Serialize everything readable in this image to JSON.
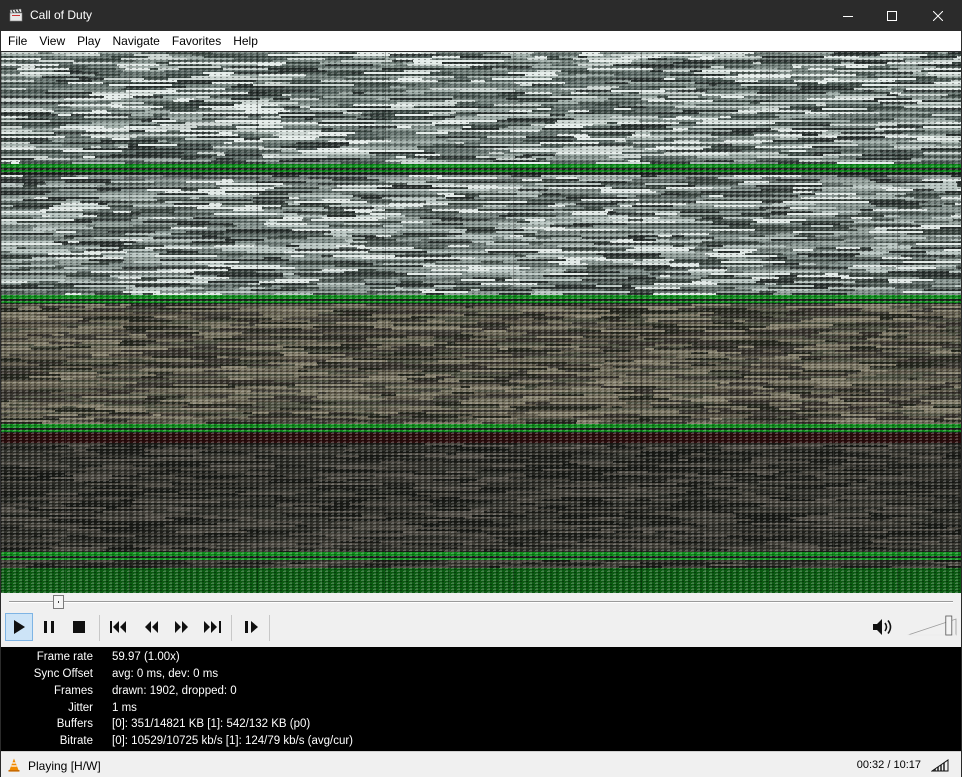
{
  "window": {
    "title": "Call of Duty",
    "icons": {
      "app": "clapperboard-icon",
      "minimize": "minimize-icon",
      "maximize": "maximize-icon",
      "close": "close-icon"
    }
  },
  "menu": {
    "items": [
      "File",
      "View",
      "Play",
      "Navigate",
      "Favorites",
      "Help"
    ]
  },
  "seek": {
    "position_fraction": 0.052
  },
  "controls": {
    "buttons": [
      {
        "name": "play",
        "icon": "play-icon",
        "active": true
      },
      {
        "name": "pause",
        "icon": "pause-icon"
      },
      {
        "name": "stop",
        "icon": "stop-icon"
      },
      {
        "name": "previous",
        "icon": "skip-back-icon"
      },
      {
        "name": "rewind",
        "icon": "rewind-icon"
      },
      {
        "name": "fast-forward",
        "icon": "fast-forward-icon"
      },
      {
        "name": "next",
        "icon": "skip-forward-icon"
      },
      {
        "name": "frame-step",
        "icon": "frame-step-icon"
      }
    ],
    "volume_icon": "speaker-icon",
    "volume_fraction": 0.85
  },
  "stats": {
    "rows": [
      {
        "label": "Frame rate",
        "value": "59.97 (1.00x)"
      },
      {
        "label": "Sync Offset",
        "value": "avg: 0 ms, dev: 0 ms"
      },
      {
        "label": "Frames",
        "value": "drawn: 1902, dropped: 0"
      },
      {
        "label": "Jitter",
        "value": "1 ms"
      },
      {
        "label": "Buffers",
        "value": "[0]: 351/14821 KB [1]: 542/132 KB (p0)"
      },
      {
        "label": "Bitrate",
        "value": "[0]: 10529/10725 kb/s [1]: 124/79 kb/s (avg/cur)"
      }
    ]
  },
  "status": {
    "text": "Playing [H/W]",
    "time": "00:32 / 10:17",
    "icons": {
      "status": "vlc-cone-icon",
      "signal": "signal-strength-icon"
    }
  },
  "colors": {
    "titlebar": "#2b2b2b",
    "controls_bg": "#f0f0f0",
    "stats_bg": "#000000",
    "active_button": "#cde4f7",
    "video_green": "#0f8a1c"
  }
}
